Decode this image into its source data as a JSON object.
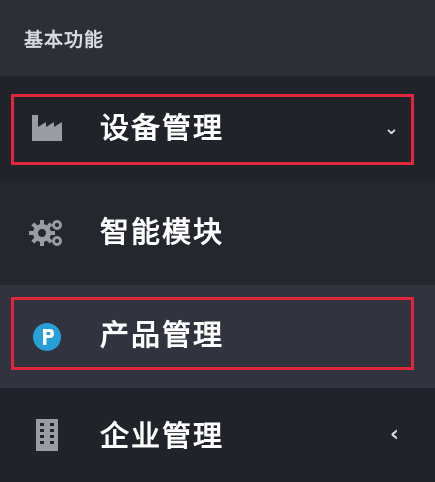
{
  "sidebar": {
    "section_title": "基本功能",
    "items": [
      {
        "label": "设备管理",
        "icon": "factory-icon",
        "chevron": "⌄",
        "expanded": true,
        "highlighted": true
      },
      {
        "label": "智能模块",
        "icon": "gears-icon",
        "chevron": "",
        "expanded": false,
        "highlighted": false
      },
      {
        "label": "产品管理",
        "icon": "p-circle-icon",
        "chevron": "",
        "expanded": false,
        "highlighted": true,
        "active": true
      },
      {
        "label": "企业管理",
        "icon": "building-icon",
        "chevron": "‹",
        "expanded": false,
        "highlighted": false
      }
    ]
  },
  "colors": {
    "background": "#25272f",
    "header_bg": "#2d2f36",
    "active_bg": "#31343e",
    "highlight_border": "#e0263a",
    "icon_accent": "#27a0d8",
    "icon_gray": "#9a9ca3"
  }
}
